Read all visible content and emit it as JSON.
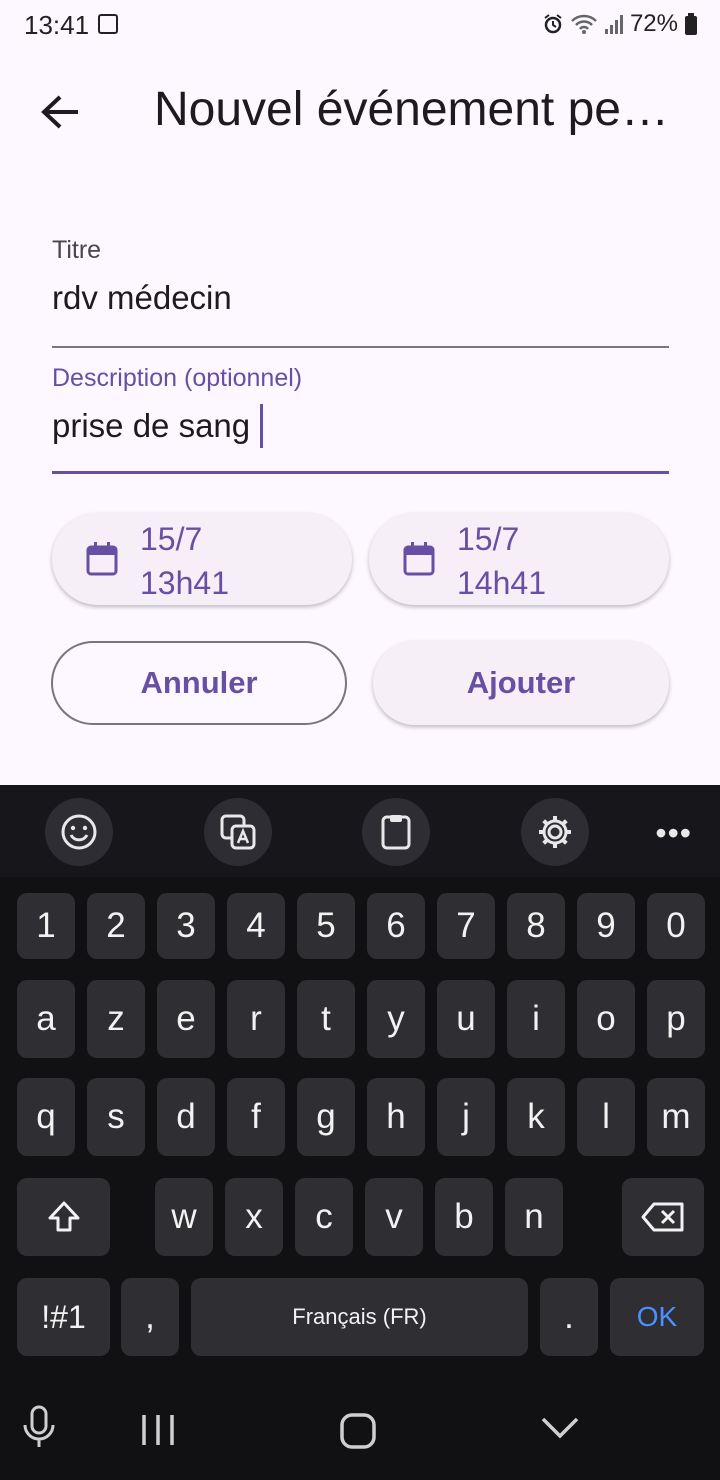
{
  "status": {
    "time": "13:41",
    "battery": "72%"
  },
  "header": {
    "title": "Nouvel événement pe…"
  },
  "form": {
    "title_label": "Titre",
    "title_value": "rdv médecin",
    "description_label": "Description (optionnel)",
    "description_value": "prise de sang"
  },
  "dates": {
    "start_date": "15/7",
    "start_time": "13h41",
    "end_date": "15/7",
    "end_time": "14h41"
  },
  "buttons": {
    "cancel": "Annuler",
    "add": "Ajouter"
  },
  "keyboard": {
    "row_numbers": [
      "1",
      "2",
      "3",
      "4",
      "5",
      "6",
      "7",
      "8",
      "9",
      "0"
    ],
    "row1": [
      "a",
      "z",
      "e",
      "r",
      "t",
      "y",
      "u",
      "i",
      "o",
      "p"
    ],
    "row2": [
      "q",
      "s",
      "d",
      "f",
      "g",
      "h",
      "j",
      "k",
      "l",
      "m"
    ],
    "row3": [
      "w",
      "x",
      "c",
      "v",
      "b",
      "n"
    ],
    "symbols_label": "!#1",
    "comma": ",",
    "space_label": "Français (FR)",
    "period": ".",
    "ok_label": "OK",
    "more_label": "•••"
  }
}
